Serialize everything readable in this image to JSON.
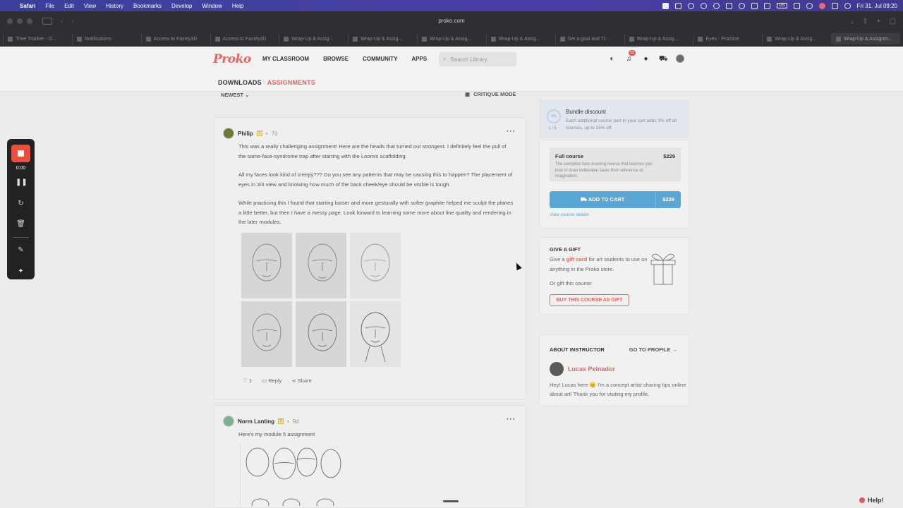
{
  "menubar": {
    "app": "Safari",
    "items": [
      "File",
      "Edit",
      "View",
      "History",
      "Bookmarks",
      "Develop",
      "Window",
      "Help"
    ],
    "clock": "Fri 31. Jul 09:20",
    "input_source": "US"
  },
  "browser": {
    "url": "proko.com",
    "tabs": [
      "Time Tracker - G...",
      "Notifications",
      "Access to Fazely3D",
      "Access to Fazely3D",
      "Wrap-Up & Assig...",
      "Wrap-Up & Assig...",
      "Wrap-Up & Assig...",
      "Wrap-Up & Assig...",
      "Set a goal and Tr...",
      "Wrap-Up & Assig...",
      "Eyes - Practice",
      "Wrap-Up & Assig...",
      "Wrap-Up & Assignm..."
    ]
  },
  "site": {
    "logo": "Proko",
    "nav": [
      "MY CLASSROOM",
      "BROWSE",
      "COMMUNITY",
      "APPS"
    ],
    "search_placeholder": "Search Library",
    "notification_count": "23",
    "subnav": {
      "downloads": "DOWNLOADS",
      "assignments": "ASSIGNMENTS"
    }
  },
  "feed": {
    "sort": "NEWEST",
    "critique": "CRITIQUE MODE"
  },
  "post1": {
    "user": "Philip",
    "level": "3",
    "age": "7d",
    "paragraphs": [
      "This was a really challenging assignment! Here are the heads that turned out strongest. I definitely feel the pull of the same-face-syndrome trap after starting with the Loomis scaffolding.",
      "All my faces look kind of creepy??? Do you see any patterns that may be causing this to happen? The placement of eyes in 3/4 view and knowing how much of the back cheek/eye should be visible is tough.",
      "While practicing this I found that starting looser and more gesturally with softer graphite helped me sculpt the planes a little better, but then I have a messy page. Look forward to learning some more about line quality and rendering in the later modules."
    ],
    "likes": "1",
    "reply": "Reply",
    "share": "Share"
  },
  "post2": {
    "user": "Norm Lanting",
    "level": "3",
    "age": "9d",
    "text": "Here's my module 5 assignment"
  },
  "bundle": {
    "percent": "0%",
    "fraction": "1 / 5",
    "title": "Bundle discount",
    "desc": "Each additional course part in your cart adds 3% off all courses, up to 15% off."
  },
  "course": {
    "name": "Full course",
    "price": "$229",
    "desc": "The complete face drawing course that teaches you how to draw believable faces from reference or imagination.",
    "cart_label": "ADD TO CART",
    "cart_price": "$229",
    "details_link": "View course details"
  },
  "gift": {
    "title": "GIVE A GIFT",
    "desc_pre": "Give a ",
    "desc_link": "gift card",
    "desc_post": " for art students to use on anything in the Proko store.",
    "or_text": "Or gift this course:",
    "button": "BUY THIS COURSE AS GIFT"
  },
  "instructor": {
    "title": "ABOUT INSTRUCTOR",
    "go": "GO TO PROFILE →",
    "name": "Lucas Peinador",
    "bio": "Hey! Lucas here 😊 I'm a concept artist sharing tips online about art! Thank you for visiting my profile."
  },
  "recorder": {
    "time": "0:00"
  },
  "help": "Help!"
}
